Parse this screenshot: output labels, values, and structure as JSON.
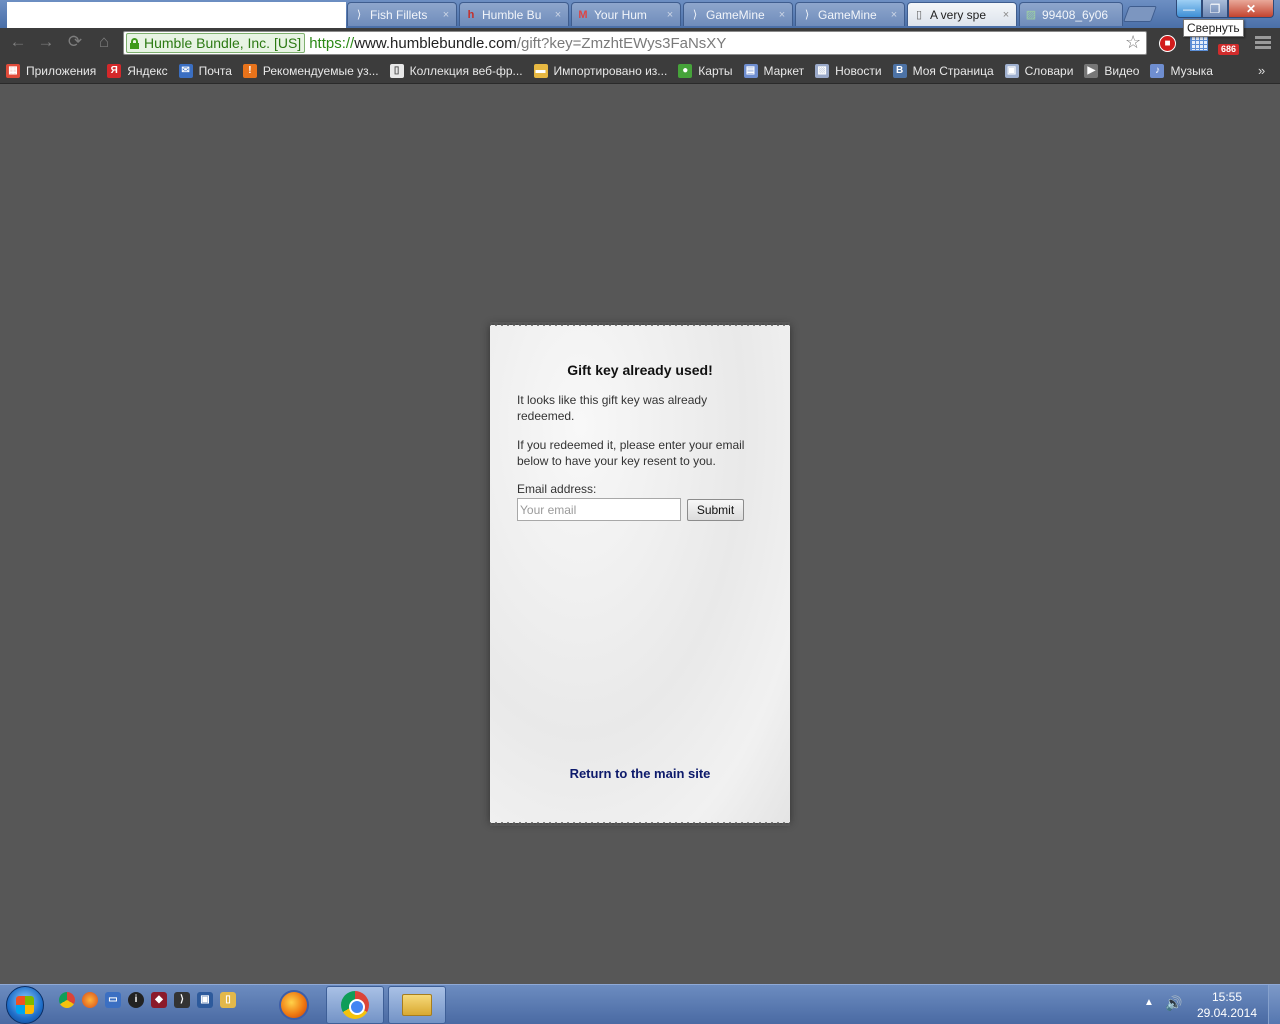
{
  "browser": {
    "tabs": [
      {
        "title": "",
        "favicon": "blank",
        "active": false
      },
      {
        "title": "Fish Fillets",
        "favicon": "chevron-icon",
        "active": false
      },
      {
        "title": "Humble Bu",
        "favicon": "humble-icon",
        "active": false
      },
      {
        "title": "Your Hum",
        "favicon": "gmail-icon",
        "active": false
      },
      {
        "title": "GameMine",
        "favicon": "chevron-icon",
        "active": false
      },
      {
        "title": "GameMine",
        "favicon": "chevron-icon",
        "active": false
      },
      {
        "title": "A very spe",
        "favicon": "document-icon",
        "active": true
      },
      {
        "title": "99408_6y06",
        "favicon": "image-icon",
        "active": false
      }
    ],
    "tab_close_glyph": "×",
    "window_tooltip": "Свернуть",
    "window_buttons": {
      "minimize": "—",
      "maximize": "❐",
      "close": "✕"
    },
    "nav": {
      "back": "←",
      "forward": "→",
      "reload": "⟳",
      "home": "⌂"
    },
    "omnibox": {
      "ev_name": "Humble Bundle, Inc. [US]",
      "scheme": "https://",
      "host": "www.humblebundle.com",
      "path": "/gift?key=ZmzhtEWys3FaNsXY"
    },
    "star_glyph": "☆",
    "extension_badge": "686",
    "bookmarks": [
      {
        "label": "Приложения",
        "icon": "apps-grid-icon",
        "color": "#e04b3a",
        "glyph": "▦"
      },
      {
        "label": "Яндекс",
        "icon": "yandex-icon",
        "color": "#d4282a",
        "glyph": "Я"
      },
      {
        "label": "Почта",
        "icon": "mail-icon",
        "color": "#3b6fc2",
        "glyph": "✉"
      },
      {
        "label": "Рекомендуемые уз...",
        "icon": "bulb-icon",
        "color": "#e8731b",
        "glyph": "!"
      },
      {
        "label": "Коллекция веб-фр...",
        "icon": "page-icon",
        "color": "#e8e8e8",
        "glyph": "▯"
      },
      {
        "label": "Импортировано из...",
        "icon": "folder-icon",
        "color": "#e7b842",
        "glyph": "▬"
      },
      {
        "label": "Карты",
        "icon": "maps-icon",
        "color": "#46a33a",
        "glyph": "●"
      },
      {
        "label": "Маркет",
        "icon": "market-icon",
        "color": "#6f8ed0",
        "glyph": "▤"
      },
      {
        "label": "Новости",
        "icon": "news-icon",
        "color": "#9aa9c9",
        "glyph": "▧"
      },
      {
        "label": "Моя Страница",
        "icon": "vk-icon",
        "color": "#4d73a6",
        "glyph": "B"
      },
      {
        "label": "Словари",
        "icon": "dictionary-icon",
        "color": "#9fb0cf",
        "glyph": "▣"
      },
      {
        "label": "Видео",
        "icon": "video-icon",
        "color": "#777777",
        "glyph": "▶"
      },
      {
        "label": "Музыка",
        "icon": "music-icon",
        "color": "#6f8ed0",
        "glyph": "♪"
      }
    ],
    "bookmarks_more": "»"
  },
  "page": {
    "heading": "Gift key already used!",
    "paragraph1": "It looks like this gift key was already redeemed.",
    "paragraph2": "If you redeemed it, please enter your email below to have your key resent to you.",
    "email_label": "Email address:",
    "email_placeholder": "Your email",
    "email_value": "",
    "submit_label": "Submit",
    "return_link": "Return to the main site"
  },
  "taskbar": {
    "clock_time": "15:55",
    "clock_date": "29.04.2014",
    "tray_arrow": "▲",
    "volume_glyph": "🔊"
  },
  "colors": {
    "page_background": "#575757",
    "link": "#0d1a6b",
    "url_scheme": "#2c8a17"
  }
}
